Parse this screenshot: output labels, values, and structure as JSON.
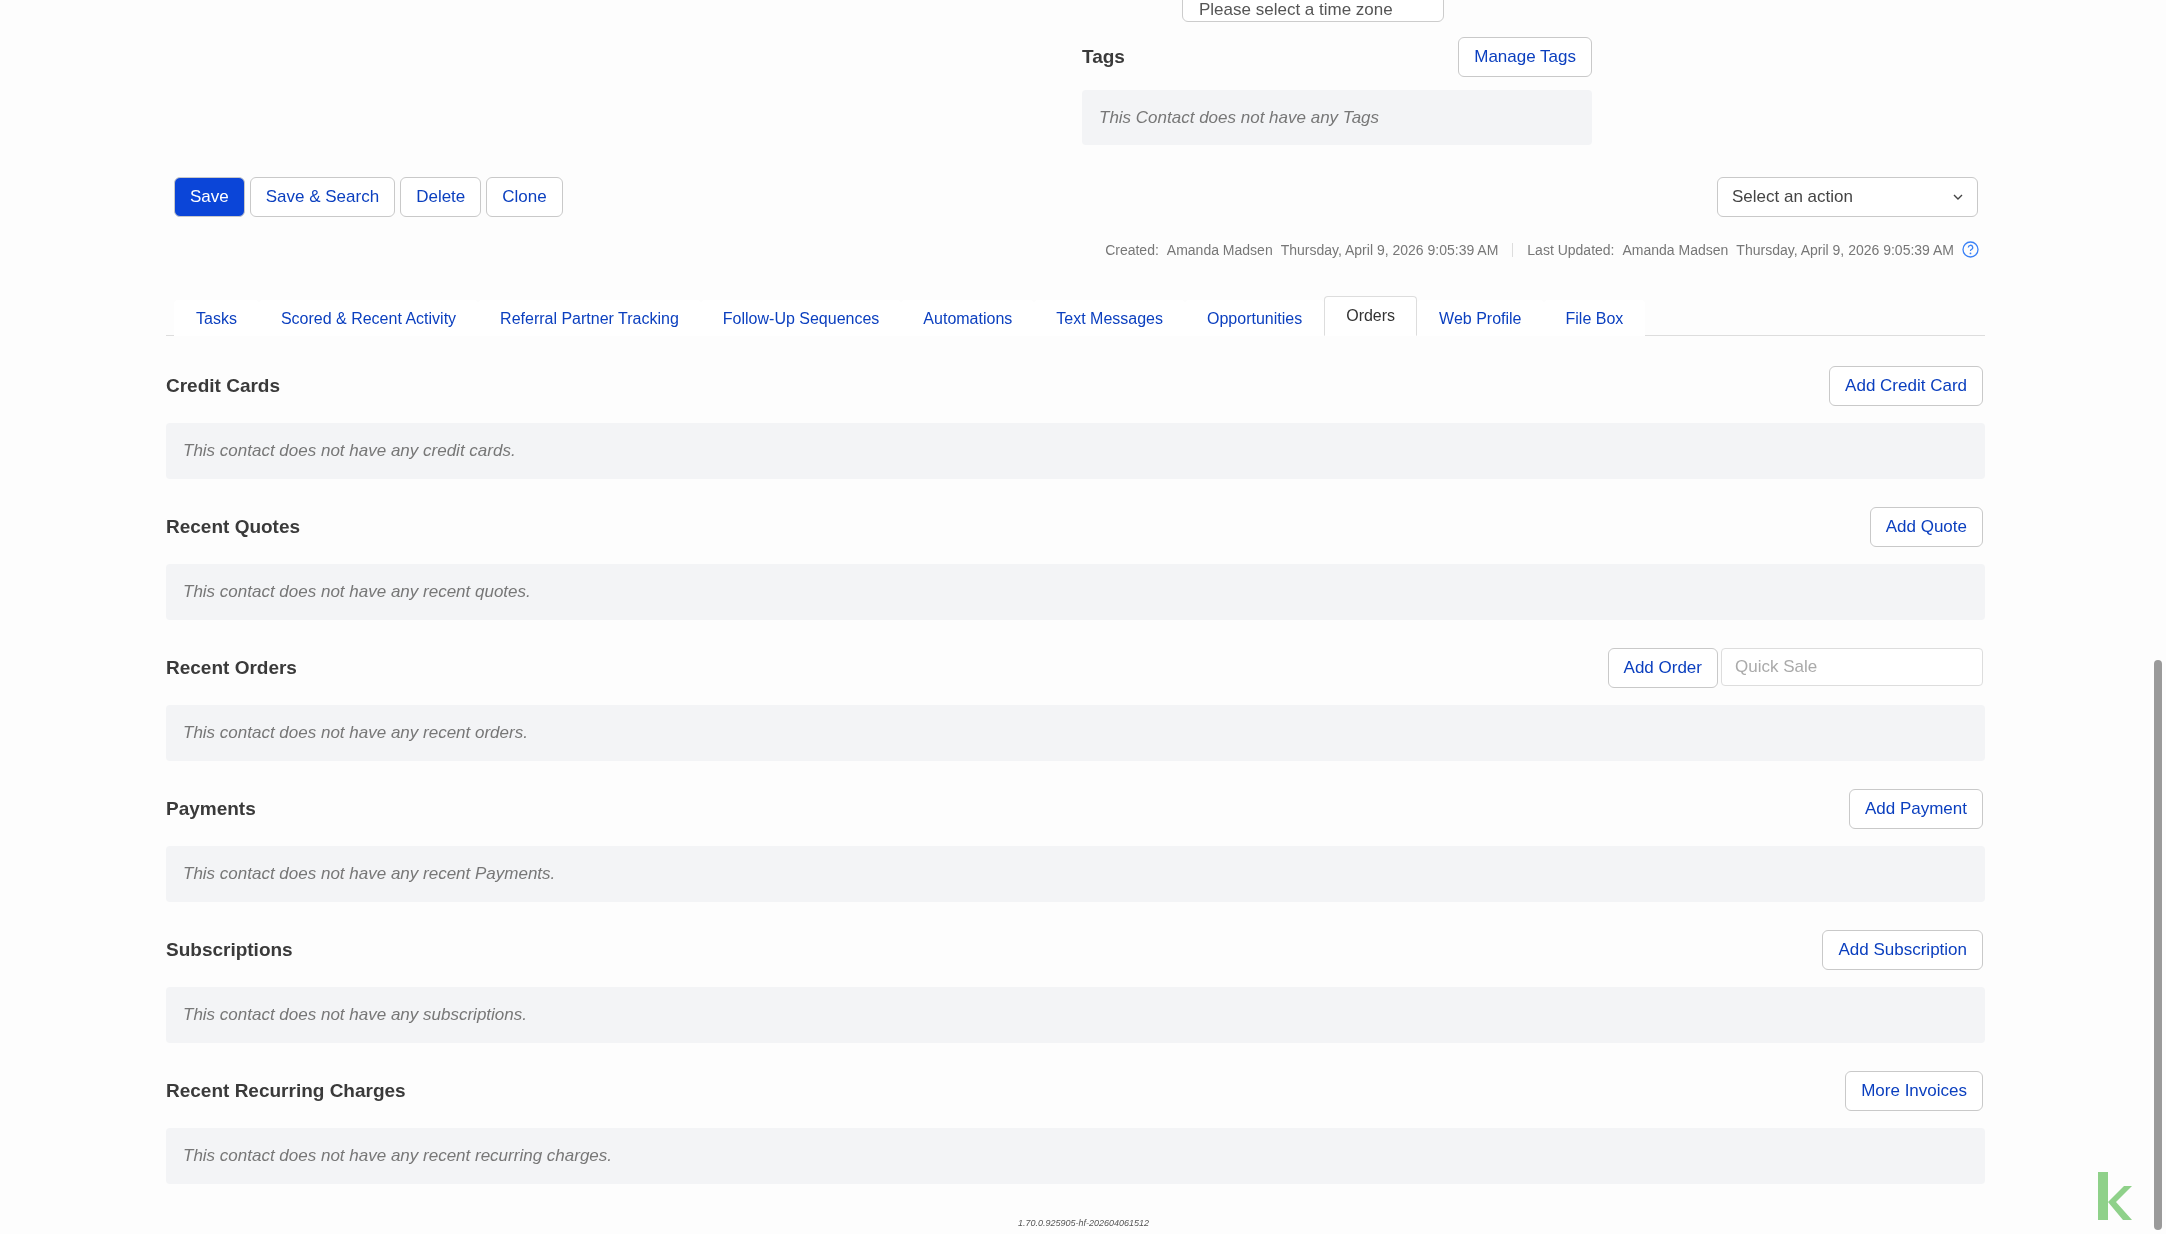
{
  "timezone_field": {
    "placeholder": "Please select a time zone"
  },
  "tags": {
    "title": "Tags",
    "button": "Manage Tags",
    "empty": "This Contact does not have any Tags"
  },
  "actions": [
    {
      "label": "Save",
      "primary": true
    },
    {
      "label": "Save & Search",
      "primary": false
    },
    {
      "label": "Delete",
      "primary": false
    },
    {
      "label": "Clone",
      "primary": false
    }
  ],
  "action_select": {
    "placeholder": "Select an action"
  },
  "meta": {
    "created_label": "Created:",
    "created_by": "Amanda Madsen",
    "created_at": "Thursday, April 9, 2026 9:05:39 AM",
    "updated_label": "Last Updated:",
    "updated_by": "Amanda Madsen",
    "updated_at": "Thursday, April 9, 2026 9:05:39 AM"
  },
  "tabs": [
    {
      "label": "Tasks",
      "selected": false
    },
    {
      "label": "Scored & Recent Activity",
      "selected": false
    },
    {
      "label": "Referral Partner Tracking",
      "selected": false
    },
    {
      "label": "Follow-Up Sequences",
      "selected": false
    },
    {
      "label": "Automations",
      "selected": false
    },
    {
      "label": "Text Messages",
      "selected": false
    },
    {
      "label": "Opportunities",
      "selected": false
    },
    {
      "label": "Orders",
      "selected": true
    },
    {
      "label": "Web Profile",
      "selected": false
    },
    {
      "label": "File Box",
      "selected": false
    }
  ],
  "sections": [
    {
      "title": "Credit Cards",
      "button": "Add Credit Card",
      "empty": "This contact does not have any credit cards."
    },
    {
      "title": "Recent Quotes",
      "button": "Add Quote",
      "empty": "This contact does not have any recent quotes."
    },
    {
      "title": "Recent Orders",
      "button": "Add Order",
      "field_placeholder": "Quick Sale",
      "empty": "This contact does not have any recent orders."
    },
    {
      "title": "Payments",
      "button": "Add Payment",
      "empty": "This contact does not have any recent Payments."
    },
    {
      "title": "Subscriptions",
      "button": "Add Subscription",
      "empty": "This contact does not have any subscriptions."
    },
    {
      "title": "Recent Recurring Charges",
      "button": "More Invoices",
      "empty": "This contact does not have any recent recurring charges."
    }
  ],
  "version": "1.70.0.925905-hf-202604061512"
}
